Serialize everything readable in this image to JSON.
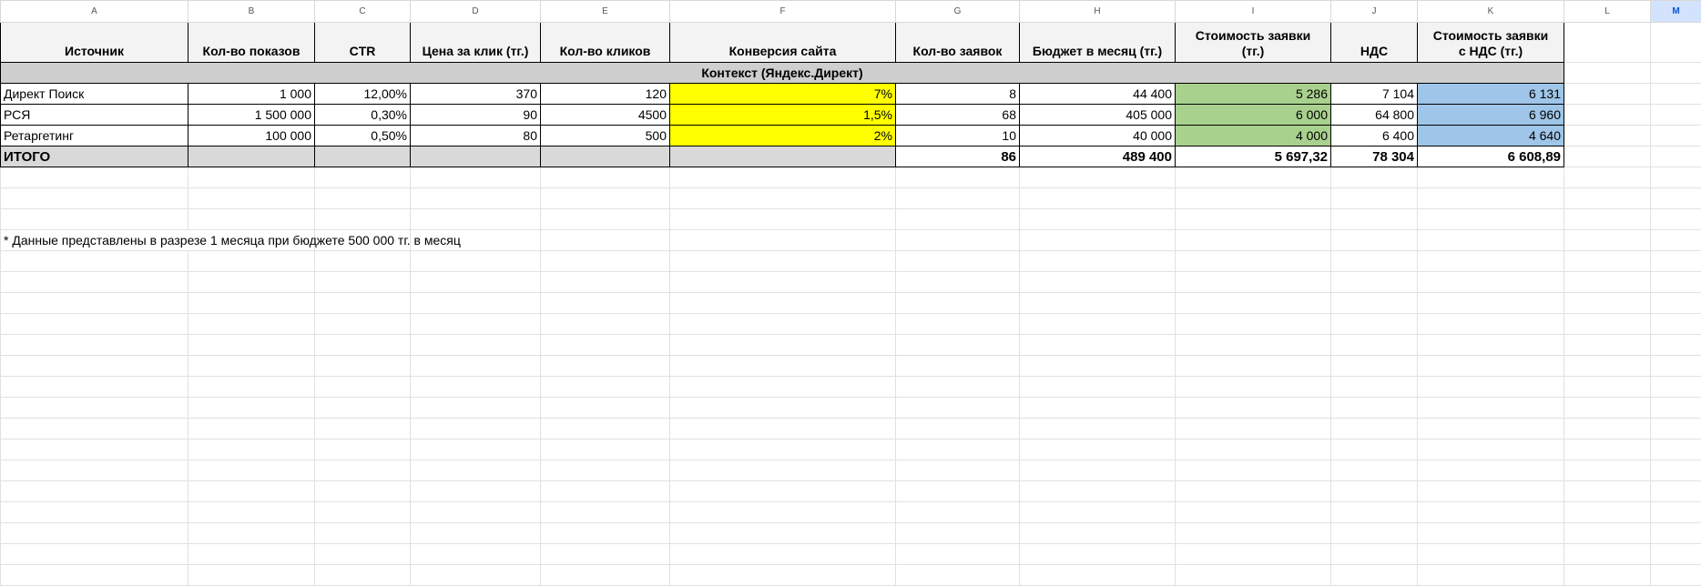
{
  "columns": [
    "A",
    "B",
    "C",
    "D",
    "E",
    "F",
    "G",
    "H",
    "I",
    "J",
    "K",
    "L",
    "M"
  ],
  "headers": [
    "Источник",
    "Кол-во показов",
    "CTR",
    "Цена за клик (тг.)",
    "Кол-во кликов",
    "Конверсия сайта",
    "Кол-во заявок",
    "Бюджет в месяц (тг.)",
    "Стоимость заявки (тг.)",
    "НДС",
    "Стоимость заявки с НДС (тг.)"
  ],
  "section_title": "Контекст (Яндекс.Директ)",
  "rows": [
    [
      "Директ Поиск",
      "1 000",
      "12,00%",
      "370",
      "120",
      "7%",
      "8",
      "44 400",
      "5 286",
      "7 104",
      "6 131"
    ],
    [
      "РСЯ",
      "1 500 000",
      "0,30%",
      "90",
      "4500",
      "1,5%",
      "68",
      "405 000",
      "6 000",
      "64 800",
      "6 960"
    ],
    [
      "Ретаргетинг",
      "100 000",
      "0,50%",
      "80",
      "500",
      "2%",
      "10",
      "40 000",
      "4 000",
      "6 400",
      "4 640"
    ]
  ],
  "totals": {
    "label": "ИТОГО",
    "leads": "86",
    "budget": "489 400",
    "cost": "5 697,32",
    "vat": "78 304",
    "cost_vat": "6 608,89"
  },
  "footnote": "* Данные представлены в разрезе 1 месяца при бюджете 500 000 тг. в месяц",
  "colors": {
    "conversion": "#ffff00",
    "cost": "#a9d18e",
    "cost_vat": "#9fc5e8",
    "selected_column": "#d3e3fd"
  }
}
